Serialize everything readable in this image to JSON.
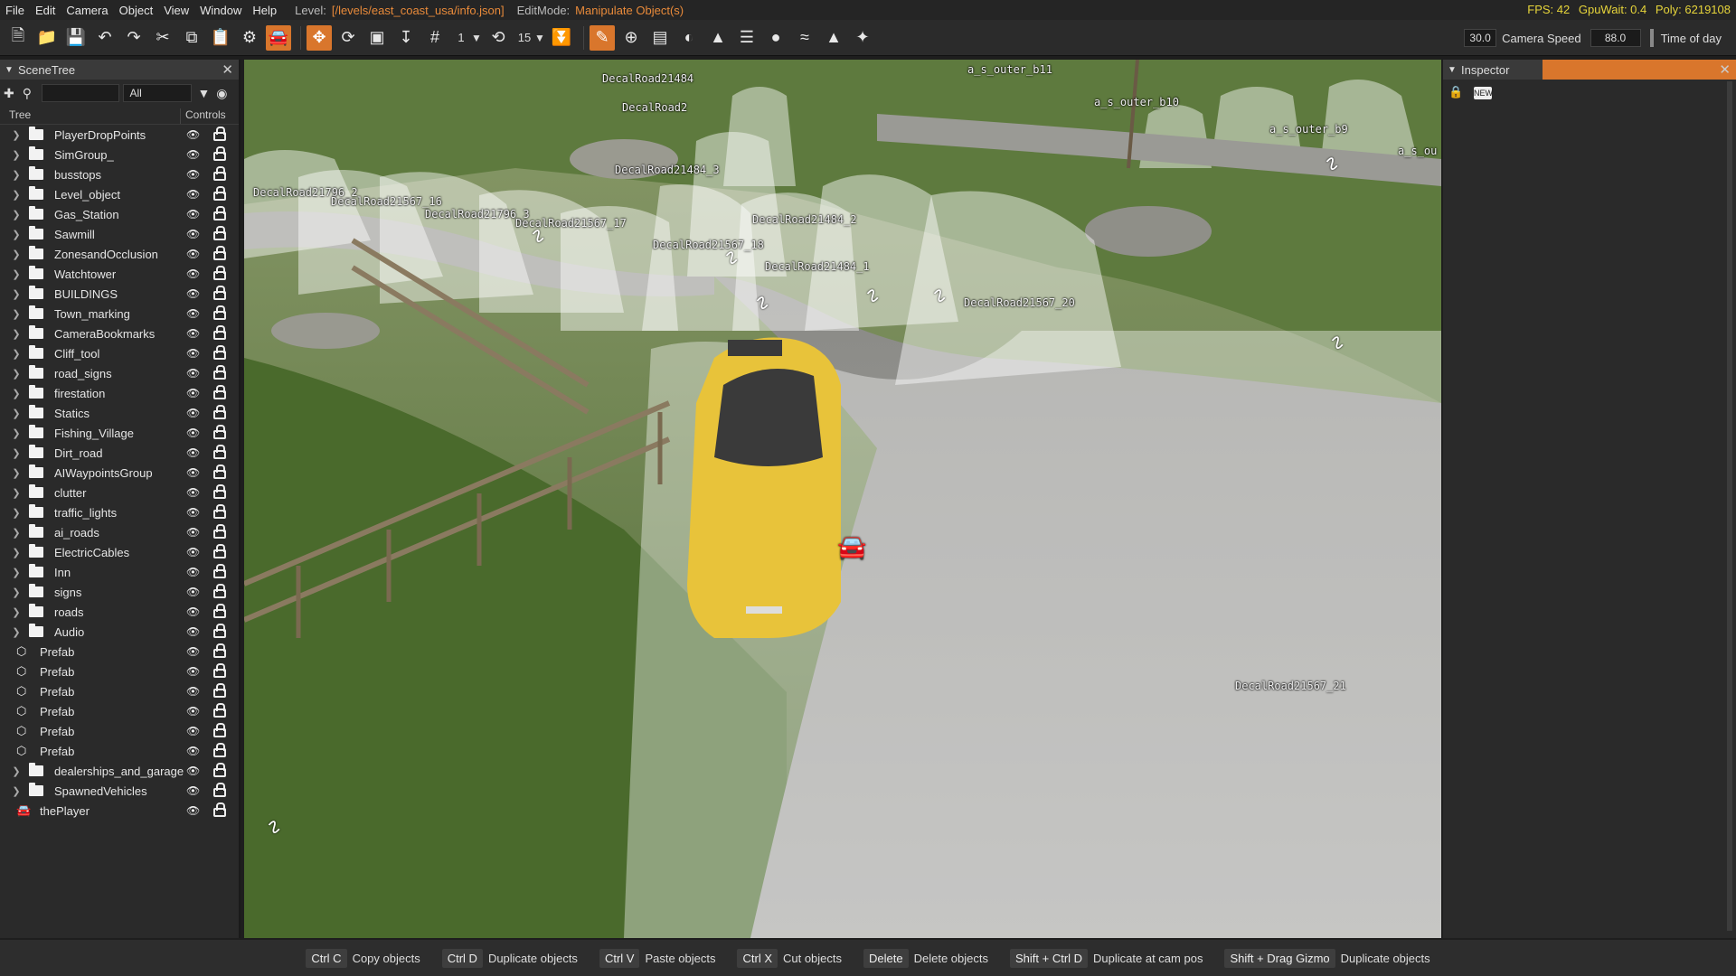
{
  "menubar": {
    "items": [
      "File",
      "Edit",
      "Camera",
      "Object",
      "View",
      "Window",
      "Help"
    ],
    "level_label": "Level:",
    "level_value": "[/levels/east_coast_usa/info.json]",
    "editmode_label": "EditMode:",
    "editmode_value": "Manipulate Object(s)",
    "fps": "FPS: 42",
    "gpuwait": "GpuWait: 0.4",
    "poly": "Poly: 6219108"
  },
  "toolbar": {
    "grid_value": "1",
    "rotate_snap": "15",
    "field_left": "30.0",
    "camera_speed_label": "Camera Speed",
    "camera_speed_value": "88.0",
    "time_of_day_label": "Time of day"
  },
  "scenetree": {
    "title": "SceneTree",
    "filter_value": "All",
    "col_tree": "Tree",
    "col_controls": "Controls",
    "rows": [
      {
        "label": "PlayerDropPoints",
        "kind": "folder"
      },
      {
        "label": "SimGroup_",
        "kind": "folder"
      },
      {
        "label": "busstops",
        "kind": "folder"
      },
      {
        "label": "Level_object",
        "kind": "folder"
      },
      {
        "label": "Gas_Station",
        "kind": "folder"
      },
      {
        "label": "Sawmill",
        "kind": "folder"
      },
      {
        "label": "ZonesandOcclusion",
        "kind": "folder"
      },
      {
        "label": "Watchtower",
        "kind": "folder"
      },
      {
        "label": "BUILDINGS",
        "kind": "folder"
      },
      {
        "label": "Town_marking",
        "kind": "folder"
      },
      {
        "label": "CameraBookmarks",
        "kind": "folder"
      },
      {
        "label": "Cliff_tool",
        "kind": "folder"
      },
      {
        "label": "road_signs",
        "kind": "folder"
      },
      {
        "label": "firestation",
        "kind": "folder"
      },
      {
        "label": "Statics",
        "kind": "folder"
      },
      {
        "label": "Fishing_Village",
        "kind": "folder"
      },
      {
        "label": "Dirt_road",
        "kind": "folder"
      },
      {
        "label": "AIWaypointsGroup",
        "kind": "folder"
      },
      {
        "label": "clutter",
        "kind": "folder"
      },
      {
        "label": "traffic_lights",
        "kind": "folder"
      },
      {
        "label": "ai_roads",
        "kind": "folder"
      },
      {
        "label": "ElectricCables",
        "kind": "folder"
      },
      {
        "label": "Inn",
        "kind": "folder"
      },
      {
        "label": "signs",
        "kind": "folder"
      },
      {
        "label": "roads",
        "kind": "folder"
      },
      {
        "label": "Audio",
        "kind": "folder"
      },
      {
        "label": "Prefab",
        "kind": "prefab"
      },
      {
        "label": "Prefab",
        "kind": "prefab"
      },
      {
        "label": "Prefab",
        "kind": "prefab"
      },
      {
        "label": "Prefab",
        "kind": "prefab"
      },
      {
        "label": "Prefab",
        "kind": "prefab"
      },
      {
        "label": "Prefab",
        "kind": "prefab"
      },
      {
        "label": "dealerships_and_garage",
        "kind": "folder"
      },
      {
        "label": "SpawnedVehicles",
        "kind": "folder"
      },
      {
        "label": "thePlayer",
        "kind": "vehicle"
      }
    ]
  },
  "viewport": {
    "labels": [
      "DecalRoad21484",
      "DecalRoad2",
      "DecalRoad21484_3",
      "DecalRoad21796_2",
      "DecalRoad21567_16",
      "DecalRoad21796_3",
      "DecalRoad21567_17",
      "DecalRoad21484_2",
      "DecalRoad21567_18",
      "DecalRoad21484_1",
      "DecalRoad21567_20",
      "DecalRoad21567_21",
      "a_s_outer_b11",
      "a_s_outer_b10",
      "a_s_outer_b9",
      "a_s_ou"
    ]
  },
  "inspector": {
    "title": "Inspector",
    "new_badge": "NEW"
  },
  "statusbar": {
    "hints": [
      {
        "key": "Ctrl C",
        "desc": "Copy objects"
      },
      {
        "key": "Ctrl D",
        "desc": "Duplicate objects"
      },
      {
        "key": "Ctrl V",
        "desc": "Paste objects"
      },
      {
        "key": "Ctrl X",
        "desc": "Cut objects"
      },
      {
        "key": "Delete",
        "desc": "Delete objects"
      },
      {
        "key": "Shift + Ctrl D",
        "desc": "Duplicate at cam pos"
      },
      {
        "key": "Shift + Drag Gizmo",
        "desc": "Duplicate objects"
      }
    ]
  },
  "colors": {
    "accent": "#d9762c",
    "perf": "#e6d43a",
    "level_path": "#e88a3a"
  }
}
